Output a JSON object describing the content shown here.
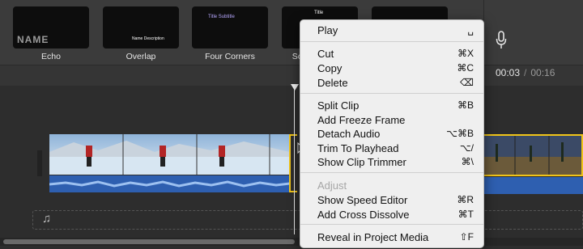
{
  "title_templates": [
    {
      "label": "Echo",
      "thumb_text": "NAME"
    },
    {
      "label": "Overlap",
      "thumb_text": "Name Description"
    },
    {
      "label": "Four Corners",
      "thumb_text": "Title Subtitle"
    },
    {
      "label": "Sc",
      "thumb_text": "Title"
    },
    {
      "label": "",
      "thumb_text": ""
    }
  ],
  "timecode": {
    "current": "00:03",
    "separator": "/",
    "duration": "00:16"
  },
  "context_menu": {
    "items": [
      {
        "label": "Play",
        "shortcut": "␣",
        "disabled": false
      },
      {
        "label": "Cut",
        "shortcut": "⌘X",
        "disabled": false
      },
      {
        "label": "Copy",
        "shortcut": "⌘C",
        "disabled": false
      },
      {
        "label": "Delete",
        "shortcut": "⌫",
        "disabled": false
      },
      {
        "label": "Split Clip",
        "shortcut": "⌘B",
        "disabled": false
      },
      {
        "label": "Add Freeze Frame",
        "shortcut": "",
        "disabled": false
      },
      {
        "label": "Detach Audio",
        "shortcut": "⌥⌘B",
        "disabled": false
      },
      {
        "label": "Trim To Playhead",
        "shortcut": "⌥/",
        "disabled": false
      },
      {
        "label": "Show Clip Trimmer",
        "shortcut": "⌘\\",
        "disabled": false
      },
      {
        "label": "Adjust",
        "shortcut": "",
        "disabled": true
      },
      {
        "label": "Show Speed Editor",
        "shortcut": "⌘R",
        "disabled": false
      },
      {
        "label": "Add Cross Dissolve",
        "shortcut": "⌘T",
        "disabled": false
      },
      {
        "label": "Reveal in Project Media",
        "shortcut": "⇧F",
        "disabled": false
      }
    ]
  },
  "colors": {
    "selection": "#f0c419",
    "audio_track": "#2e5fb0",
    "menu_bg": "#efefef"
  },
  "icons": [
    "microphone-icon",
    "music-note-icon",
    "playhead-icon",
    "pointer-cursor-icon"
  ]
}
